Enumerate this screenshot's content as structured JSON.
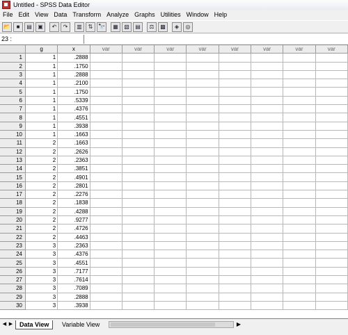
{
  "window": {
    "title": "Untitled - SPSS Data Editor"
  },
  "menu": [
    "File",
    "Edit",
    "View",
    "Data",
    "Transform",
    "Analyze",
    "Graphs",
    "Utilities",
    "Window",
    "Help"
  ],
  "toolbar": {
    "buttons": [
      {
        "icon": "open-icon",
        "glyph": "📂"
      },
      {
        "icon": "save-icon",
        "glyph": "■"
      },
      {
        "icon": "print-icon",
        "glyph": "▤"
      },
      {
        "icon": "dialog-recall-icon",
        "glyph": "▣"
      },
      {
        "icon": "undo-icon",
        "glyph": "↶"
      },
      {
        "icon": "redo-icon",
        "glyph": "↷"
      },
      {
        "icon": "goto-chart-icon",
        "glyph": "▥"
      },
      {
        "icon": "goto-case-icon",
        "glyph": "⇅"
      },
      {
        "icon": "find-icon",
        "glyph": "🔭"
      },
      {
        "icon": "insert-case-icon",
        "glyph": "▦"
      },
      {
        "icon": "insert-variable-icon",
        "glyph": "▧"
      },
      {
        "icon": "split-file-icon",
        "glyph": "▤"
      },
      {
        "icon": "weight-cases-icon",
        "glyph": "⚖"
      },
      {
        "icon": "select-cases-icon",
        "glyph": "▩"
      },
      {
        "icon": "value-labels-icon",
        "glyph": "◈"
      },
      {
        "icon": "use-sets-icon",
        "glyph": "◎"
      }
    ]
  },
  "cell_editor": {
    "reference": "23 :",
    "value": ""
  },
  "grid": {
    "columns": [
      "g",
      "x",
      "var",
      "var",
      "var",
      "var",
      "var",
      "var",
      "var",
      "var"
    ],
    "rows": [
      {
        "n": "1",
        "g": "1",
        "x": ".2888"
      },
      {
        "n": "2",
        "g": "1",
        "x": ".1750"
      },
      {
        "n": "3",
        "g": "1",
        "x": ".2888"
      },
      {
        "n": "4",
        "g": "1",
        "x": ".2100"
      },
      {
        "n": "5",
        "g": "1",
        "x": ".1750"
      },
      {
        "n": "6",
        "g": "1",
        "x": ".5339"
      },
      {
        "n": "7",
        "g": "1",
        "x": ".4376"
      },
      {
        "n": "8",
        "g": "1",
        "x": ".4551"
      },
      {
        "n": "9",
        "g": "1",
        "x": ".3938"
      },
      {
        "n": "10",
        "g": "1",
        "x": ".1663"
      },
      {
        "n": "11",
        "g": "2",
        "x": ".1663"
      },
      {
        "n": "12",
        "g": "2",
        "x": ".2626"
      },
      {
        "n": "13",
        "g": "2",
        "x": ".2363"
      },
      {
        "n": "14",
        "g": "2",
        "x": ".3851"
      },
      {
        "n": "15",
        "g": "2",
        "x": ".4901"
      },
      {
        "n": "16",
        "g": "2",
        "x": ".2801"
      },
      {
        "n": "17",
        "g": "2",
        "x": ".2276"
      },
      {
        "n": "18",
        "g": "2",
        "x": ".1838"
      },
      {
        "n": "19",
        "g": "2",
        "x": ".4288"
      },
      {
        "n": "20",
        "g": "2",
        "x": ".9277"
      },
      {
        "n": "21",
        "g": "2",
        "x": ".4726"
      },
      {
        "n": "22",
        "g": "2",
        "x": ".4463"
      },
      {
        "n": "23",
        "g": "3",
        "x": ".2363"
      },
      {
        "n": "24",
        "g": "3",
        "x": ".4376"
      },
      {
        "n": "25",
        "g": "3",
        "x": ".4551"
      },
      {
        "n": "26",
        "g": "3",
        "x": ".7177"
      },
      {
        "n": "27",
        "g": "3",
        "x": ".7614"
      },
      {
        "n": "28",
        "g": "3",
        "x": ".7089"
      },
      {
        "n": "29",
        "g": "3",
        "x": ".2888"
      },
      {
        "n": "30",
        "g": "3",
        "x": ".3938"
      }
    ]
  },
  "tabs": {
    "data_view": "Data View",
    "variable_view": "Variable View"
  }
}
